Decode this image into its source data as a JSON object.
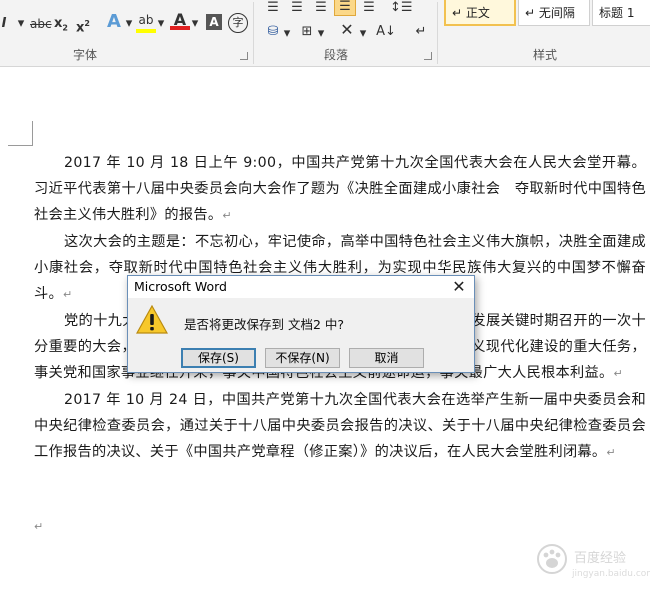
{
  "ribbon": {
    "font_group_label": "字体",
    "paragraph_group_label": "段落",
    "styles_group_label": "样式",
    "styles": [
      {
        "label": "↵ 正文",
        "selected": true
      },
      {
        "label": "↵ 无间隔",
        "selected": false
      },
      {
        "label": "标题 1",
        "selected": false
      }
    ],
    "colors": {
      "highlight": "#ffff00",
      "font_color": "#e02020",
      "accent": "#2b579a"
    }
  },
  "document": {
    "paragraphs": [
      "2017 年 10 月 18 日上午 9:00，中国共产党第十九次全国代表大会在人民大会堂开幕。习近平代表第十八届中央委员会向大会作了题为《决胜全面建成小康社会　夺取新时代中国特色社会主义伟大胜利》的报告。",
      "这次大会的主题是：不忘初心，牢记使命，高举中国特色社会主义伟大旗帜，决胜全面建成小康社会，夺取新时代中国特色社会主义伟大胜利，为实现中华民族伟大复兴的中国梦不懈奋斗。",
      "党的十九大是在全面建成小康社会决胜阶段、中国特色社会主义发展关键时期召开的一次十分重要的大会，承担着谋划决胜全面建成小康社会、深入推进社会主义现代化建设的重大任务，事关党和国家事业继往开来，事关中国特色社会主义前途命运，事关最广大人民根本利益。",
      "2017 年 10 月 24 日，中国共产党第十九次全国代表大会在选举产生新一届中央委员会和中央纪律检查委员会，通过关于十八届中央委员会报告的决议、关于十八届中央纪律检查委员会工作报告的决议、关于《中国共产党章程（修正案）》的决议后，在人民大会堂胜利闭幕。"
    ],
    "paragraph_mark": "↵"
  },
  "dialog": {
    "title": "Microsoft Word",
    "close_glyph": "✕",
    "message": "是否将更改保存到 文档2 中?",
    "buttons": {
      "save": "保存(S)",
      "dont_save": "不保存(N)",
      "cancel": "取消"
    },
    "icon": "warning-icon"
  },
  "watermark": {
    "text": "百度经验",
    "url": "jingyan.baidu.com"
  }
}
